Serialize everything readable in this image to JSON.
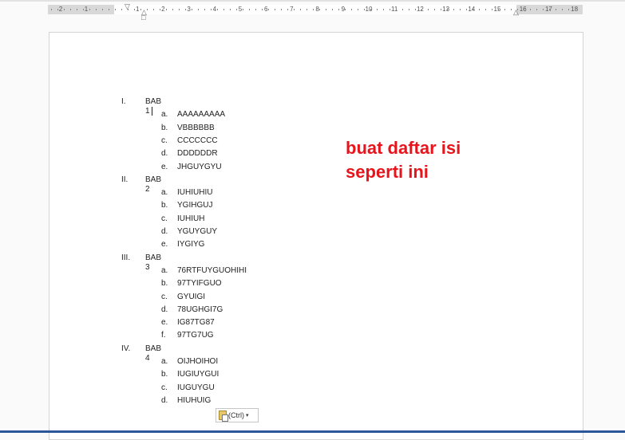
{
  "ruler": {
    "left_numbers": [
      "2",
      "1"
    ],
    "right_numbers": [
      "1",
      "2",
      "3",
      "4",
      "5",
      "6",
      "7",
      "8",
      "9",
      "10",
      "11",
      "12",
      "13",
      "14",
      "15",
      "16",
      "17",
      "18"
    ]
  },
  "list": [
    {
      "num": "I.",
      "title": "BAB 1",
      "items": [
        {
          "l": "a.",
          "t": "AAAAAAAAA"
        },
        {
          "l": "b.",
          "t": "VBBBBBB"
        },
        {
          "l": "c.",
          "t": "CCCCCCC"
        },
        {
          "l": "d.",
          "t": "DDDDDDR"
        },
        {
          "l": "e.",
          "t": "JHGUYGYU"
        }
      ]
    },
    {
      "num": "II.",
      "title": "BAB 2",
      "items": [
        {
          "l": "a.",
          "t": "IUHIUHIU"
        },
        {
          "l": "b.",
          "t": "YGIHGUJ"
        },
        {
          "l": "c.",
          "t": "IUHIUH"
        },
        {
          "l": "d.",
          "t": "YGUYGUY"
        },
        {
          "l": "e.",
          "t": "IYGIYG"
        }
      ]
    },
    {
      "num": "III.",
      "title": "BAB 3",
      "items": [
        {
          "l": "a.",
          "t": "76RTFUYGUOHIHI"
        },
        {
          "l": "b.",
          "t": "97TYIFGUO"
        },
        {
          "l": "c.",
          "t": "GYUIGI"
        },
        {
          "l": "d.",
          "t": "78UGHGI7G"
        },
        {
          "l": "e.",
          "t": "IG87TG87"
        },
        {
          "l": "f.",
          "t": "97TG7UG"
        }
      ]
    },
    {
      "num": "IV.",
      "title": "BAB 4",
      "items": [
        {
          "l": "a.",
          "t": "OIJHOIHOI"
        },
        {
          "l": "b.",
          "t": "IUGIUYGUI"
        },
        {
          "l": "c.",
          "t": "IUGUYGU"
        },
        {
          "l": "d.",
          "t": "HIUHUIG"
        }
      ]
    }
  ],
  "note": {
    "line1": "buat daftar isi",
    "line2": "seperti ini"
  },
  "paste_options": {
    "label": "(Ctrl)",
    "arrow": "▾"
  },
  "colors": {
    "note": "#e8141b",
    "statusbar": "#2b579a"
  }
}
